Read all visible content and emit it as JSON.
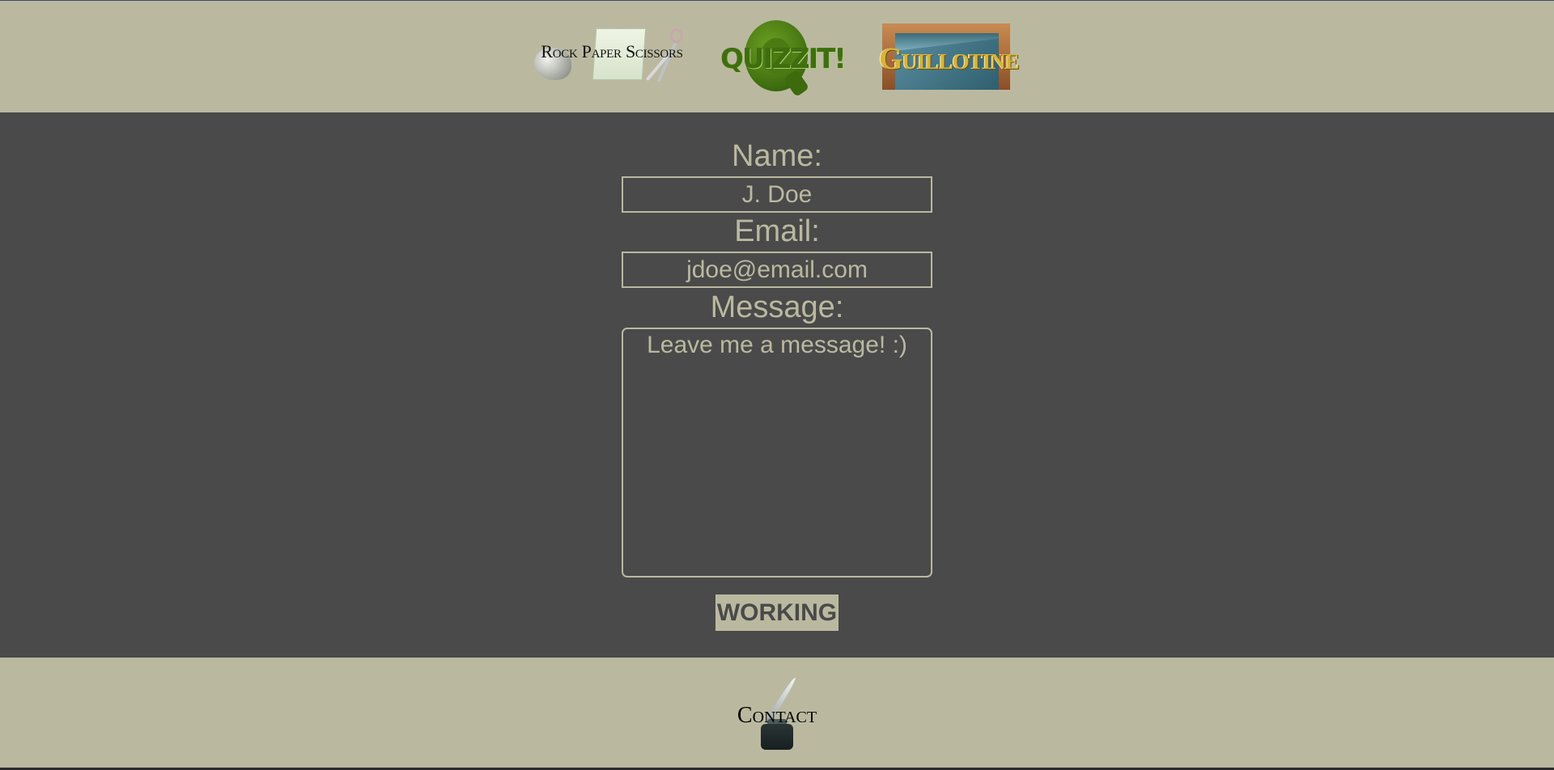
{
  "nav": {
    "rps_label": "Rock Paper Scissors",
    "quiz_label": "QUIZZIT!",
    "guillotine_label": "Guillotine"
  },
  "form": {
    "name_label": "Name:",
    "name_placeholder": "J. Doe",
    "email_label": "Email:",
    "email_placeholder": "jdoe@email.com",
    "message_label": "Message:",
    "message_placeholder": "Leave me a message! :)",
    "submit_label": "WORKING"
  },
  "footer": {
    "contact_label": "Contact"
  },
  "colors": {
    "background": "#bab9a0",
    "panel": "#4a4a4a",
    "accent_text": "#bab9a0"
  }
}
